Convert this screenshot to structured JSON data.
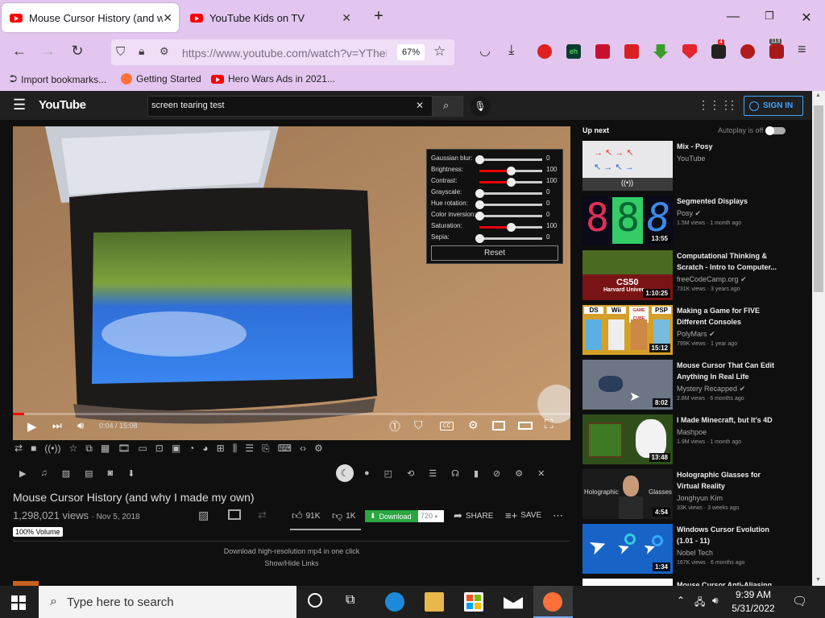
{
  "browser": {
    "tabs": [
      {
        "label": "Mouse Cursor History (and why I made my own)",
        "active": true
      },
      {
        "label": "YouTube Kids on TV",
        "active": false
      }
    ],
    "url": "https://www.youtube.com/watch?v=YTheL",
    "zoom": "67%",
    "extension_badges": {
      "ublock": "4",
      "other": "113"
    },
    "bookmarks": [
      "Import bookmarks...",
      "Getting Started",
      "Hero Wars Ads in 2021..."
    ]
  },
  "youtube": {
    "logo": "YouTube",
    "search_value": "screen tearing test",
    "signin_label": "SIGN IN"
  },
  "player": {
    "filters": [
      {
        "label": "Gaussian blur:",
        "value": "0",
        "level": 0,
        "active": false
      },
      {
        "label": "Brightness:",
        "value": "100",
        "level": 0.5,
        "active": true
      },
      {
        "label": "Contrast:",
        "value": "100",
        "level": 0.5,
        "active": true
      },
      {
        "label": "Grayscale:",
        "value": "0",
        "level": 0,
        "active": false
      },
      {
        "label": "Hue rotation:",
        "value": "0",
        "level": 0,
        "active": false
      },
      {
        "label": "Color inversion:",
        "value": "0",
        "level": 0,
        "active": false
      },
      {
        "label": "Saturation:",
        "value": "100",
        "level": 0.5,
        "active": true
      },
      {
        "label": "Sepia:",
        "value": "0",
        "level": 0,
        "active": false
      }
    ],
    "reset_label": "Reset",
    "time": "0:04 / 15:08",
    "progress": 0.0044
  },
  "video": {
    "title": "Mouse Cursor History (and why I made my own)",
    "views": "1,298,021 views",
    "date": "· Nov 5, 2018",
    "volume_badge": "100% Volume",
    "likes": "91K",
    "dislikes": "1K",
    "download_label": "Download",
    "quality": "720",
    "share_label": "SHARE",
    "save_label": "SAVE",
    "download_info": "Download high-resolution mp4 in one click",
    "show_hide": "Show/Hide Links"
  },
  "sidebar": {
    "up_next": "Up next",
    "autoplay": "Autoplay is off",
    "videos": [
      {
        "title": "Mix - Posy",
        "channel": "YouTube",
        "meta": "",
        "duration": ""
      },
      {
        "title": "Segmented Displays",
        "channel": "Posy",
        "meta": "1.5M views · 1 month ago",
        "duration": "13:55"
      },
      {
        "title": "Computational Thinking & Scratch - Intro to Computer...",
        "channel": "freeCodeCamp.org",
        "meta": "731K views · 3 years ago",
        "duration": "1:10:25"
      },
      {
        "title": "Making a Game for FIVE Different Consoles",
        "channel": "PolyMars",
        "meta": "799K views · 1 year ago",
        "duration": "15:12"
      },
      {
        "title": "Mouse Cursor That Can Edit Anything In Real Life",
        "channel": "Mystery Recapped",
        "meta": "2.8M views · 6 months ago",
        "duration": "8:02"
      },
      {
        "title": "I Made Minecraft, but It's 4D",
        "channel": "Mashpoe",
        "meta": "1.9M views · 1 month ago",
        "duration": "13:48"
      },
      {
        "title": "Holographic Glasses for Virtual Reality",
        "channel": "Jonghyun Kim",
        "meta": "33K views · 3 weeks ago",
        "duration": "4:54"
      },
      {
        "title": "Windows Cursor Evolution (1.01 - 11)",
        "channel": "Nobel Tech",
        "meta": "167K views · 6 months ago",
        "duration": "1:34"
      },
      {
        "title": "Mouse Cursor Anti-Aliasing",
        "channel": "",
        "meta": "",
        "duration": ""
      }
    ],
    "thumb_texts": {
      "cs50": "CS50",
      "harvard": "Harvard Univer",
      "ds": "DS",
      "wii": "Wii",
      "gamecube": "GAME CUBE",
      "psp": "PSP",
      "holo_left": "Holographic",
      "holo_right": "Glasses"
    }
  },
  "taskbar": {
    "search_placeholder": "Type here to search",
    "time": "9:39 AM",
    "date": "5/31/2022"
  }
}
